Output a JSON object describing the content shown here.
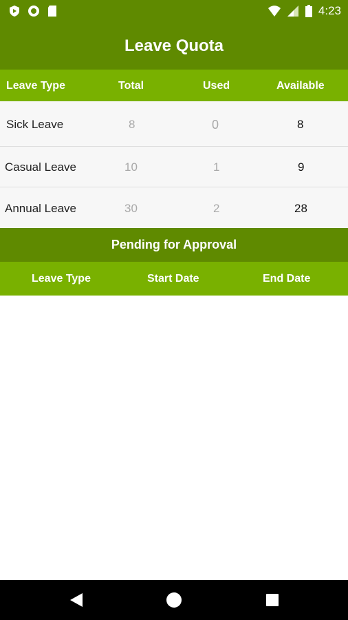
{
  "status_bar": {
    "left_icons": [
      "shield-icon",
      "circle-record-icon",
      "sd-card-icon"
    ],
    "right_icons": [
      "wifi-icon",
      "signal-icon",
      "battery-icon"
    ],
    "time": "4:23"
  },
  "app_bar": {
    "title": "Leave Quota"
  },
  "quota_table": {
    "headers": [
      "Leave Type",
      "Total",
      "Used",
      "Available"
    ],
    "rows": [
      {
        "type": "Sick Leave",
        "total": "8",
        "used": "0",
        "available": "8"
      },
      {
        "type": "Casual Leave",
        "total": "10",
        "used": "1",
        "available": "9"
      },
      {
        "type": "Annual Leave",
        "total": "30",
        "used": "2",
        "available": "28"
      }
    ]
  },
  "pending": {
    "title": "Pending for Approval",
    "headers": [
      "Leave Type",
      "Start Date",
      "End Date"
    ]
  },
  "nav_bar": {
    "icons": [
      "back-icon",
      "home-icon",
      "recents-icon"
    ]
  },
  "colors": {
    "dark_green": "#5f8a00",
    "light_green": "#79b100"
  }
}
